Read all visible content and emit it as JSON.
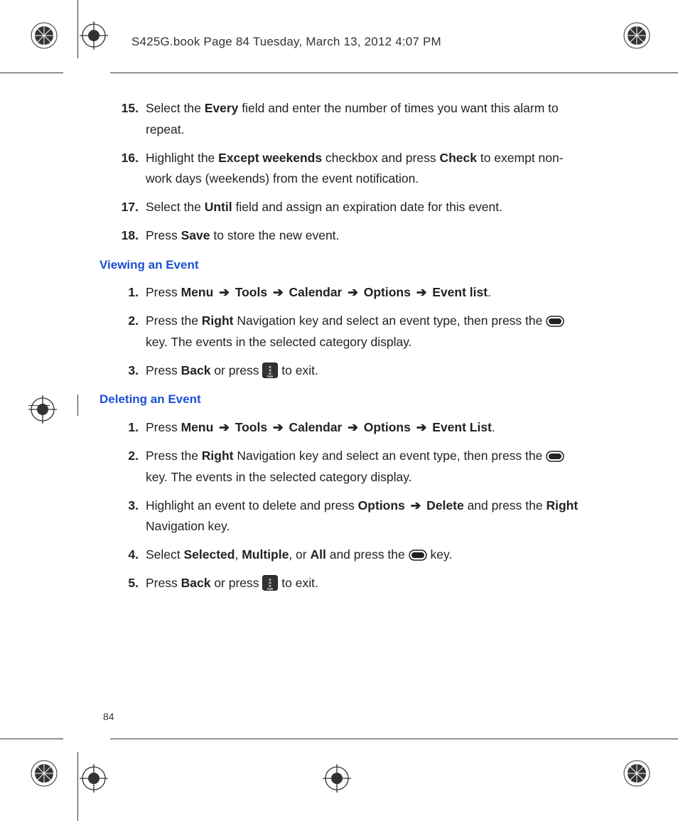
{
  "header": "S425G.book  Page 84  Tuesday, March 13, 2012  4:07 PM",
  "page_number": "84",
  "arrow": "➔",
  "steps_a": [
    {
      "n": "15.",
      "parts": [
        {
          "t": "Select the "
        },
        {
          "t": "Every",
          "b": true
        },
        {
          "t": " field and enter the number of times you want this alarm to repeat."
        }
      ]
    },
    {
      "n": "16.",
      "parts": [
        {
          "t": "Highlight the "
        },
        {
          "t": "Except weekends",
          "b": true
        },
        {
          "t": " checkbox and press "
        },
        {
          "t": "Check",
          "b": true
        },
        {
          "t": " to exempt non-work days (weekends) from the event notification."
        }
      ]
    },
    {
      "n": "17.",
      "parts": [
        {
          "t": "Select the "
        },
        {
          "t": "Until",
          "b": true
        },
        {
          "t": " field and assign an expiration date for this event."
        }
      ]
    },
    {
      "n": "18.",
      "parts": [
        {
          "t": "Press "
        },
        {
          "t": "Save",
          "b": true
        },
        {
          "t": " to store the new event."
        }
      ]
    }
  ],
  "section_view": "Viewing an Event",
  "steps_b": [
    {
      "n": "1.",
      "parts": [
        {
          "t": "Press "
        },
        {
          "t": "Menu",
          "b": true
        },
        {
          "arrow": true
        },
        {
          "t": "Tools",
          "b": true
        },
        {
          "arrow": true
        },
        {
          "t": "Calendar",
          "b": true
        },
        {
          "arrow": true
        },
        {
          "t": "Options",
          "b": true
        },
        {
          "arrow": true
        },
        {
          "t": "Event list",
          "b": true
        },
        {
          "t": "."
        }
      ]
    },
    {
      "n": "2.",
      "parts": [
        {
          "t": "Press the "
        },
        {
          "t": "Right",
          "b": true
        },
        {
          "t": " Navigation key and select an event type, then press the "
        },
        {
          "icon": "oval"
        },
        {
          "t": " key. The events in the selected category display."
        }
      ]
    },
    {
      "n": "3.",
      "parts": [
        {
          "t": "Press "
        },
        {
          "t": "Back",
          "b": true
        },
        {
          "t": " or press "
        },
        {
          "icon": "end"
        },
        {
          "t": " to exit."
        }
      ]
    }
  ],
  "section_delete": "Deleting an Event",
  "steps_c": [
    {
      "n": "1.",
      "parts": [
        {
          "t": "Press "
        },
        {
          "t": "Menu",
          "b": true
        },
        {
          "arrow": true
        },
        {
          "t": "Tools",
          "b": true
        },
        {
          "arrow": true
        },
        {
          "t": "Calendar",
          "b": true
        },
        {
          "arrow": true
        },
        {
          "t": "Options",
          "b": true
        },
        {
          "arrow": true
        },
        {
          "t": "Event List",
          "b": true
        },
        {
          "t": "."
        }
      ]
    },
    {
      "n": "2.",
      "parts": [
        {
          "t": "Press the "
        },
        {
          "t": "Right",
          "b": true
        },
        {
          "t": " Navigation key and select an event type, then press the "
        },
        {
          "icon": "oval"
        },
        {
          "t": " key. The events in the selected category display."
        }
      ]
    },
    {
      "n": "3.",
      "parts": [
        {
          "t": "Highlight an event to delete and press "
        },
        {
          "t": "Options ",
          "b": true
        },
        {
          "arrow": true
        },
        {
          "t": "Delete",
          "b": true
        },
        {
          "t": " and press the "
        },
        {
          "t": "Right",
          "b": true
        },
        {
          "t": " Navigation key."
        }
      ]
    },
    {
      "n": "4.",
      "parts": [
        {
          "t": "Select "
        },
        {
          "t": "Selected",
          "b": true
        },
        {
          "t": ", "
        },
        {
          "t": "Multiple",
          "b": true
        },
        {
          "t": ", or "
        },
        {
          "t": "All",
          "b": true
        },
        {
          "t": " and press the "
        },
        {
          "icon": "oval"
        },
        {
          "t": " key."
        }
      ]
    },
    {
      "n": "5.",
      "parts": [
        {
          "t": "Press "
        },
        {
          "t": "Back",
          "b": true
        },
        {
          "t": " or press "
        },
        {
          "icon": "end"
        },
        {
          "t": " to exit."
        }
      ]
    }
  ]
}
